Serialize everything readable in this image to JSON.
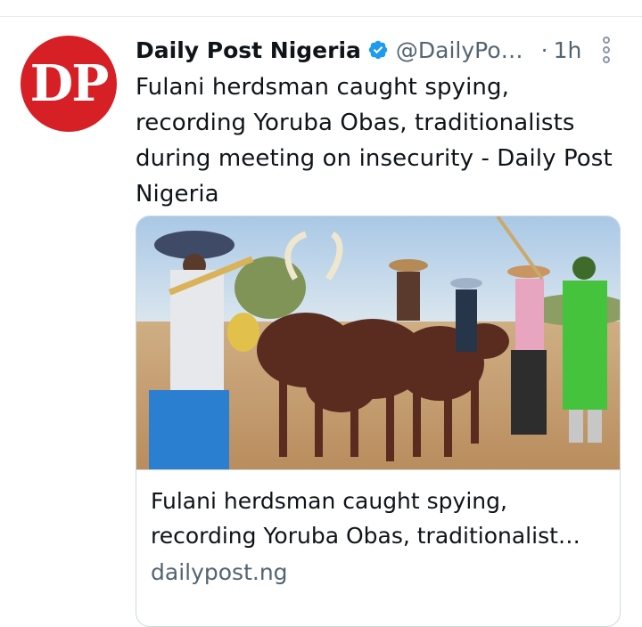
{
  "tweet": {
    "avatar_text": "DP",
    "author_name": "Daily Post Nigeria",
    "handle": "@DailyPo…",
    "separator": "·",
    "time": "1h",
    "text": "Fulani herdsman caught spying,\nrecording Yoruba Obas, traditionalists\nduring meeting on insecurity - Daily Post\nNigeria",
    "more_icon": "vertical-ellipsis-icon",
    "verified_icon": "verified-badge-icon"
  },
  "card": {
    "image_icon": "news-photo",
    "title": "Fulani herdsman caught spying,\nrecording Yoruba Obas, traditionalist…",
    "domain": "dailypost.ng"
  },
  "colors": {
    "brand_red": "#d71f26",
    "verified_blue": "#1d9bf0",
    "secondary_text": "#536471"
  }
}
